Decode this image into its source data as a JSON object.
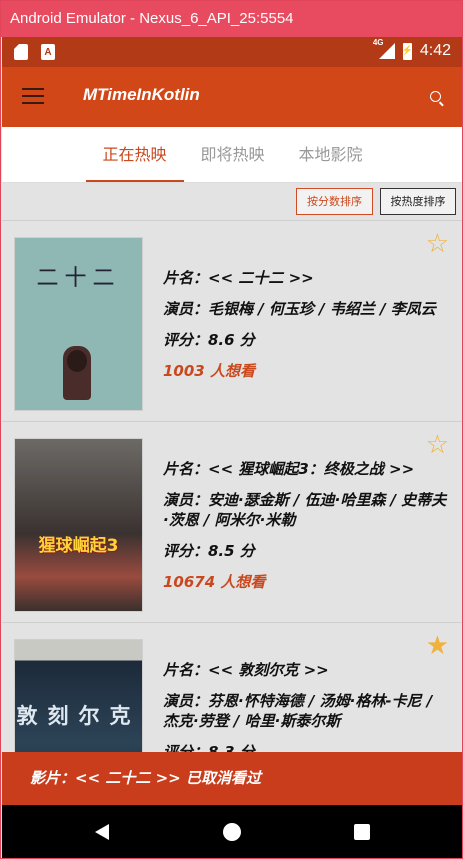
{
  "window": {
    "title": "Android Emulator - Nexus_6_API_25:5554"
  },
  "statusbar": {
    "signal_label": "4G",
    "time": "4:42",
    "icons": [
      "sd-card-icon",
      "a-notification-icon",
      "signal-icon",
      "battery-icon"
    ]
  },
  "toolbar": {
    "title": "MTimeInKotlin",
    "menu_icon": "hamburger-icon",
    "search_icon": "search-icon"
  },
  "tabs": [
    {
      "label": "正在热映",
      "active": true
    },
    {
      "label": "即将热映",
      "active": false
    },
    {
      "label": "本地影院",
      "active": false
    }
  ],
  "sort": {
    "by_score": "按分数排序",
    "by_heat": "按热度排序"
  },
  "movies": [
    {
      "poster_title": "二十二",
      "name": "片名：<< 二十二 >>",
      "actors": "演员：毛银梅 / 何玉珍 / 韦绍兰 / 李凤云",
      "score": "评分：8.6 分",
      "want": "1003 人想看",
      "favorited": false
    },
    {
      "poster_title": "猩球崛起3",
      "name": "片名：<< 猩球崛起3：终极之战 >>",
      "actors": "演员：安迪·瑟金斯 / 伍迪·哈里森 / 史蒂夫·茨恩 / 阿米尔·米勒",
      "score": "评分：8.5 分",
      "want": "10674 人想看",
      "favorited": false
    },
    {
      "poster_title": "敦刻尔克",
      "name": "片名：<< 敦刻尔克 >>",
      "actors": "演员：芬恩·怀特海德 / 汤姆·格林-卡尼 / 杰克·劳登 / 哈里·斯泰尔斯",
      "score": "评分：8.3 分",
      "want": "",
      "favorited": true
    }
  ],
  "snackbar": {
    "message": "影片：<< 二十二 >> 已取消看过"
  },
  "colors": {
    "primary": "#d24718",
    "primary_dark": "#b33a17",
    "accent_text": "#c9481d",
    "star": "#f0b23c"
  }
}
